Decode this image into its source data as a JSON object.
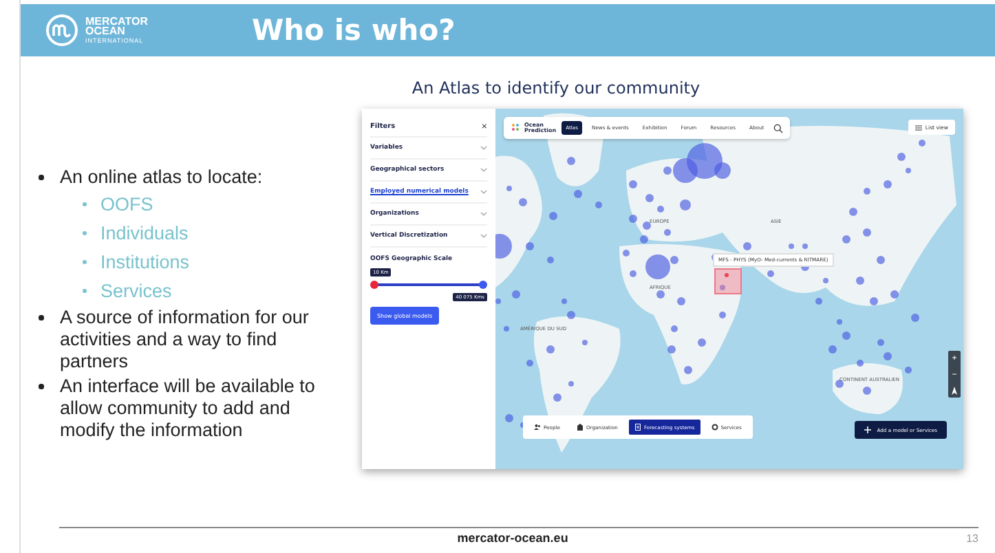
{
  "header": {
    "logo_lines": [
      "MERCATOR",
      "OCEAN",
      "INTERNATIONAL"
    ],
    "title": "Who is who?"
  },
  "subtitle": "An Atlas to identify our community",
  "bullets": [
    {
      "text": "An online atlas to locate:",
      "children": [
        {
          "text": "OOFS"
        },
        {
          "text": "Individuals"
        },
        {
          "text": "Institutions"
        },
        {
          "text": "Services"
        }
      ]
    },
    {
      "text": "A source of information for our activities and a way to find partners"
    },
    {
      "text": "An interface will be available to allow community to add and modify the information"
    }
  ],
  "screenshot": {
    "filters": {
      "title": "Filters",
      "close": "×",
      "rows": [
        {
          "label": "Variables",
          "selected": false
        },
        {
          "label": "Geographical sectors",
          "selected": false
        },
        {
          "label": "Employed numerical models",
          "selected": true
        },
        {
          "label": "Organizations",
          "selected": false
        },
        {
          "label": "Vertical Discretization",
          "selected": false
        }
      ],
      "scale": {
        "title": "OOFS Geographic Scale",
        "min_label": "10 Km",
        "max_label": "40 075 Kms",
        "level": 1
      },
      "button": "Show global models"
    },
    "nav": {
      "logo_lines": [
        "Ocean",
        "Prediction"
      ],
      "tabs": [
        {
          "label": "Atlas",
          "selected": true
        },
        {
          "label": "News & events",
          "selected": false
        },
        {
          "label": "Exhibition",
          "selected": false
        },
        {
          "label": "Forum",
          "selected": false
        },
        {
          "label": "Resources",
          "selected": false
        },
        {
          "label": "About",
          "selected": false
        }
      ],
      "list_view": "List view"
    },
    "map_labels": [
      {
        "text": "EUROPE",
        "kind": "region"
      },
      {
        "text": "ASIE",
        "kind": "region"
      },
      {
        "text": "AFRIQUE",
        "kind": "region"
      },
      {
        "text": "AMÉRIQUE DU SUD",
        "kind": "region"
      },
      {
        "text": "CONTINENT AUSTRALIEN",
        "kind": "region"
      }
    ],
    "tooltip": "MFS - PHYS (MyO- Med-currents & RITMARE)",
    "zoom": [
      "+",
      "−"
    ],
    "categories": [
      {
        "label": "People",
        "kind": "people",
        "selected": false
      },
      {
        "label": "Organization",
        "kind": "building",
        "selected": false
      },
      {
        "label": "Forecasting systems",
        "kind": "document",
        "selected": true
      },
      {
        "label": "Services",
        "kind": "gear",
        "selected": false
      }
    ],
    "add_button": "Add a model or Services"
  },
  "footer": {
    "site": "mercator-ocean.eu",
    "page": "13"
  }
}
